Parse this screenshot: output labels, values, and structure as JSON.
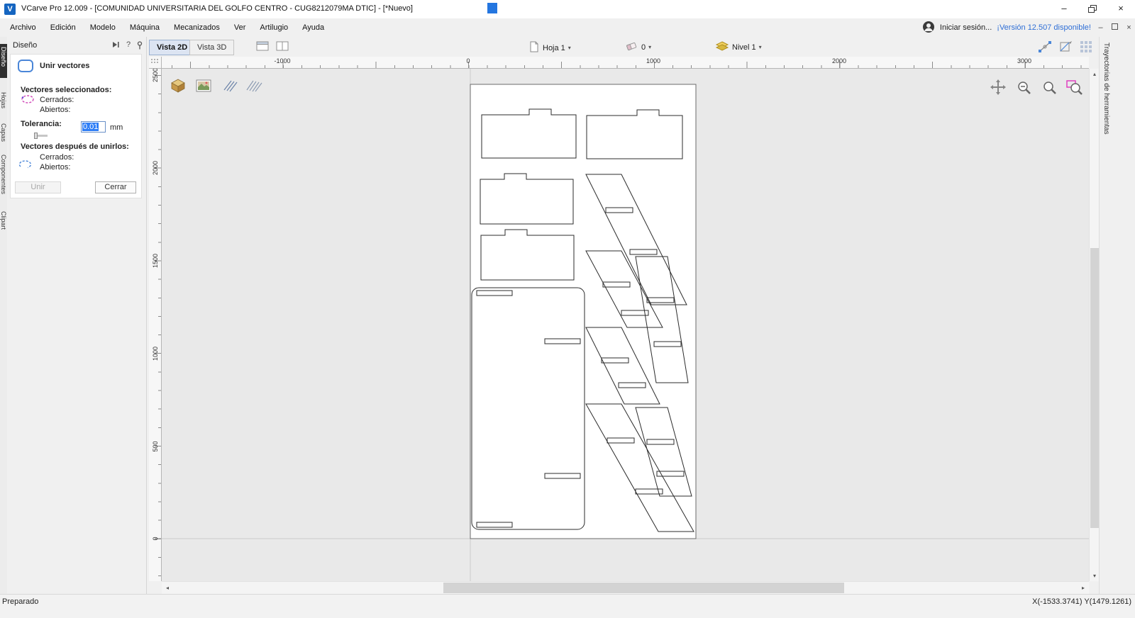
{
  "titlebar": {
    "title": "VCarve Pro 12.009 - [COMUNIDAD UNIVERSITARIA DEL GOLFO CENTRO - CUG8212079MA DTIC] - [*Nuevo]",
    "app_initial": "V"
  },
  "glyphs": {
    "minimize": "–",
    "close": "×",
    "dropdown": "▾",
    "help": "?",
    "scroll_up": "▴",
    "scroll_down": "▾",
    "scroll_left": "◂",
    "scroll_right": "▸"
  },
  "menubar": {
    "items": [
      "Archivo",
      "Edición",
      "Modelo",
      "Máquina",
      "Mecanizados",
      "Ver",
      "Artilugio",
      "Ayuda"
    ],
    "sign_in": "Iniciar sesión...",
    "version_notice": "¡Versión 12.507 disponible!"
  },
  "side_tabs": {
    "left": [
      "Diseño",
      "Hojas",
      "Capas",
      "Componentes",
      "Clipart"
    ],
    "right": "Trayectorias de herramientas"
  },
  "design_panel": {
    "title": "Diseño",
    "join_dialog": {
      "title": "Unir vectores",
      "selected_heading": "Vectores seleccionados:",
      "closed_label": "Cerrados:",
      "open_label": "Abiertos:",
      "tolerance_label": "Tolerancia:",
      "tolerance_value": "0.01",
      "tolerance_unit": "mm",
      "after_heading": "Vectores después de unirlos:",
      "after_closed_label": "Cerrados:",
      "after_open_label": "Abiertos:",
      "join_button": "Unir",
      "close_button": "Cerrar"
    }
  },
  "view_toolbar": {
    "tab_2d": "Vista 2D",
    "tab_3d": "Vista 3D",
    "sheet_selector": "Hoja 1",
    "eraser_count": "0",
    "level_selector": "Nivel 1"
  },
  "rulers": {
    "horizontal": [
      "-1000",
      "0",
      "1000",
      "2000",
      "3000"
    ],
    "vertical": [
      "2500",
      "2000",
      "1500",
      "1000",
      "500",
      "0"
    ]
  },
  "statusbar": {
    "state": "Preparado",
    "coordinates": "X(-1533.3741) Y(1479.1261)"
  }
}
